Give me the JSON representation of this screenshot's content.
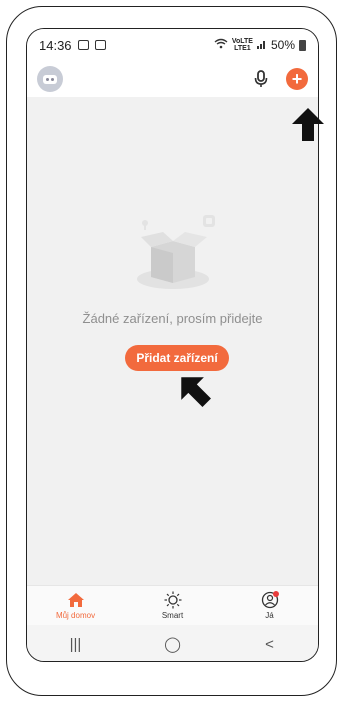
{
  "status_bar": {
    "time": "14:36",
    "network_label_top": "VoLTE",
    "network_label_bottom": "LTE1",
    "battery": "50%"
  },
  "header": {
    "avatar_icon": "robot-avatar-icon",
    "mic_icon": "microphone-icon",
    "add_icon": "plus-icon",
    "add_symbol": "+"
  },
  "main": {
    "empty_message": "Žádné zařízení, prosím přidejte",
    "add_button_label": "Přidat zařízení"
  },
  "tabs": [
    {
      "label": "Můj domov",
      "icon": "home-icon",
      "active": true
    },
    {
      "label": "Smart",
      "icon": "sun-icon",
      "active": false
    },
    {
      "label": "Já",
      "icon": "user-icon",
      "active": false
    }
  ],
  "nav": {
    "recent": "|||",
    "home": "◯",
    "back": "<"
  },
  "colors": {
    "accent": "#f26a3d",
    "background": "#f1f1f1"
  }
}
